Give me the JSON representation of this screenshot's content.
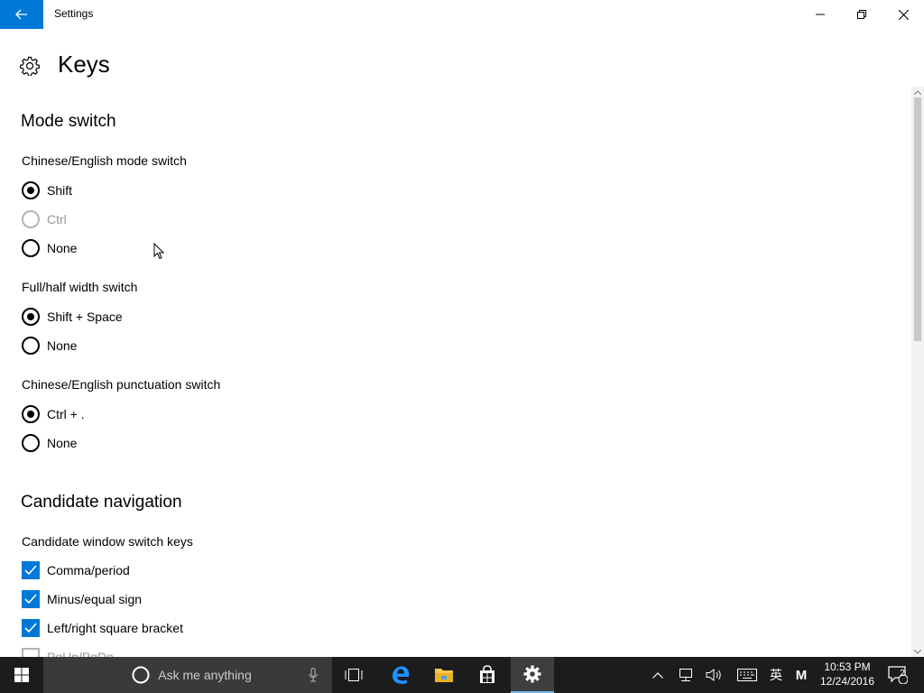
{
  "window": {
    "title": "Settings",
    "back_icon": "arrow-left-icon",
    "controls": [
      "minimize-icon",
      "restore-icon",
      "close-icon"
    ]
  },
  "page": {
    "icon": "gear-icon",
    "title": "Keys"
  },
  "sections": {
    "mode_switch": {
      "title": "Mode switch",
      "cn_en_mode": {
        "label": "Chinese/English mode switch",
        "options": [
          {
            "label": "Shift",
            "checked": true,
            "disabled": false
          },
          {
            "label": "Ctrl",
            "checked": false,
            "disabled": true
          },
          {
            "label": "None",
            "checked": false,
            "disabled": false
          }
        ]
      },
      "full_half": {
        "label": "Full/half width switch",
        "options": [
          {
            "label": "Shift + Space",
            "checked": true
          },
          {
            "label": "None",
            "checked": false
          }
        ]
      },
      "punctuation": {
        "label": "Chinese/English punctuation switch",
        "options": [
          {
            "label": "Ctrl + .",
            "checked": true
          },
          {
            "label": "None",
            "checked": false
          }
        ]
      }
    },
    "candidate_navigation": {
      "title": "Candidate navigation",
      "switch_keys": {
        "label": "Candidate window switch keys",
        "options": [
          {
            "label": "Comma/period",
            "checked": true
          },
          {
            "label": "Minus/equal sign",
            "checked": true
          },
          {
            "label": "Left/right square bracket",
            "checked": true
          },
          {
            "label": "PgUp/PgDn",
            "checked": false
          }
        ]
      }
    }
  },
  "taskbar": {
    "search_placeholder": "Ask me anything",
    "apps": [
      "windows-start-icon",
      "task-view-icon",
      "edge-icon",
      "file-explorer-icon",
      "store-icon",
      "settings-gear-icon"
    ],
    "tray": {
      "ime_char": "英",
      "ime_mode": "M",
      "time": "10:53 PM",
      "date": "12/24/2016",
      "notifications": "2"
    }
  },
  "colors": {
    "accent": "#0078d7",
    "taskbar": "#1c1c1c"
  }
}
